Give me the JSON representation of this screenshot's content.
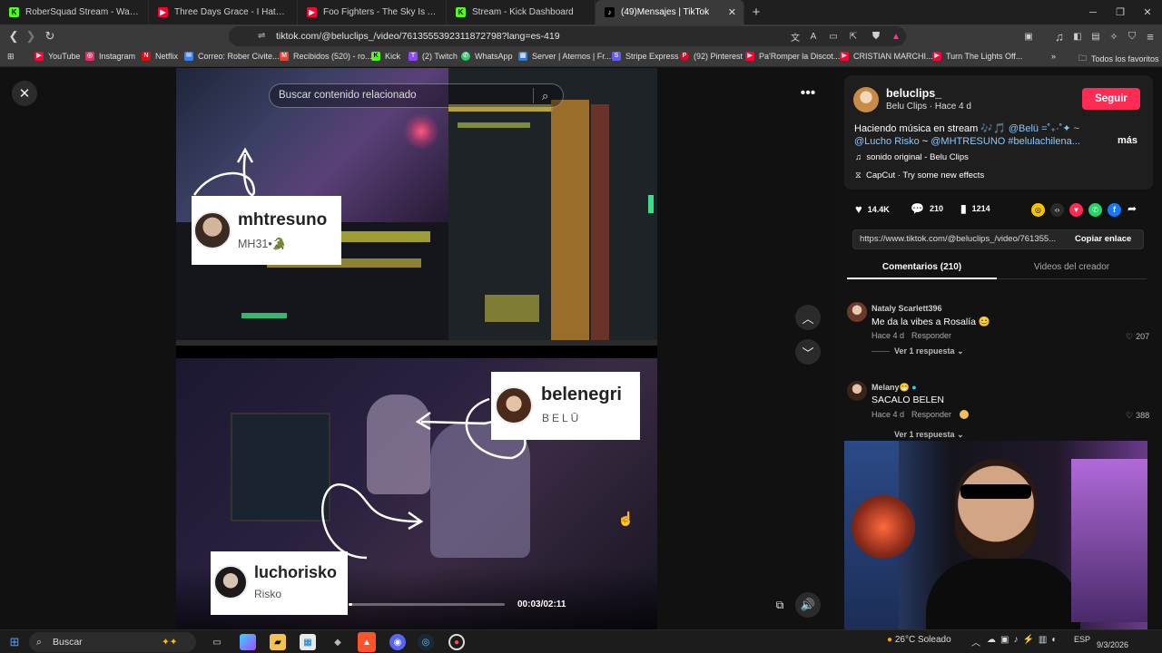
{
  "browser": {
    "tabs": [
      {
        "title": "RoberSquad Stream - Watch Live",
        "icon": "kick-icon",
        "color": "#53fc18",
        "active": false
      },
      {
        "title": "Three Days Grace - I Hate Everything",
        "icon": "youtube-icon",
        "color": "#ff0033",
        "active": false
      },
      {
        "title": "Foo Fighters - The Sky Is A Neighbor",
        "icon": "youtube-icon",
        "color": "#ff0033",
        "active": false
      },
      {
        "title": "Stream - Kick Dashboard",
        "icon": "kick-icon",
        "color": "#53fc18",
        "active": false
      },
      {
        "title": "(49)Mensajes | TikTok",
        "icon": "tiktok-icon",
        "color": "#ffffff",
        "active": true
      }
    ],
    "url": "tiktok.com/@beluclips_/video/7613555392311872798?lang=es-419",
    "bookmarks": [
      {
        "label": "YouTube",
        "color": "#ff0033"
      },
      {
        "label": "Instagram",
        "color": "#e1306c"
      },
      {
        "label": "Netflix",
        "color": "#e50914"
      },
      {
        "label": "Correo: Rober Civite...",
        "color": "#3b82f6"
      },
      {
        "label": "Recibidos (520) - ro...",
        "color": "#ea4335"
      },
      {
        "label": "Kick",
        "color": "#53fc18"
      },
      {
        "label": "(2) Twitch",
        "color": "#9146ff"
      },
      {
        "label": "WhatsApp",
        "color": "#25d366"
      },
      {
        "label": "Server | Aternos | Fr...",
        "color": "#2d7dd2"
      },
      {
        "label": "Stripe Express",
        "color": "#635bff"
      },
      {
        "label": "(92) Pinterest",
        "color": "#e60023"
      },
      {
        "label": "Pa'Romper la Discot...",
        "color": "#ff0033"
      },
      {
        "label": "CRISTIAN MARCHI...",
        "color": "#ff0033"
      },
      {
        "label": "Turn The Lights Off...",
        "color": "#ff0033"
      }
    ],
    "all_bookmarks": "Todos los favoritos"
  },
  "video": {
    "search_placeholder": "Buscar contenido relacionado",
    "tags": [
      {
        "handle": "mhtresuno",
        "name": "MH31•🐊"
      },
      {
        "handle": "belenegri",
        "name": "BELŪ"
      },
      {
        "handle": "luchorisko",
        "name": "Risko"
      }
    ],
    "time": "00:03/02:11",
    "progress": 0.023
  },
  "panel": {
    "username": "beluclips_",
    "subline": "Belu Clips · Hace 4 d",
    "follow": "Seguir",
    "caption_text": "Haciendo música en stream 🎶🎵",
    "caption_mention1": "@Belü =˚₊·˚✦ ~",
    "caption_mention2": "@Lucho Risko",
    "caption_sep": "~",
    "caption_mention3": "@MHTRESUNO #belulachilena...",
    "more": "más",
    "sound": "sonido original - Belu Clips",
    "effect": "CapCut · Try some new effects",
    "likes": "14.4K",
    "comments_count": "210",
    "saves": "1214",
    "link": "https://www.tiktok.com/@beluclips_/video/761355...",
    "copy": "Copiar enlace",
    "tab_comments": "Comentarios (210)",
    "tab_videos": "Videos del creador",
    "comments": [
      {
        "user": "Nataly Scarlett396",
        "text": "Me da la vibes a Rosalía 😊",
        "meta": "Hace 4 d",
        "reply": "Responder",
        "likes": "207",
        "replies": "Ver 1 respuesta"
      },
      {
        "user": "Melany😁",
        "text": "SACALO BELEN",
        "meta": "Hace 4 d",
        "reply": "Responder",
        "likes": "388",
        "replies": "Ver 1 respuesta"
      }
    ]
  },
  "taskbar": {
    "search": "Buscar",
    "weather": "26°C Soleado",
    "lang": "ESP",
    "date": "9/3/2026"
  }
}
